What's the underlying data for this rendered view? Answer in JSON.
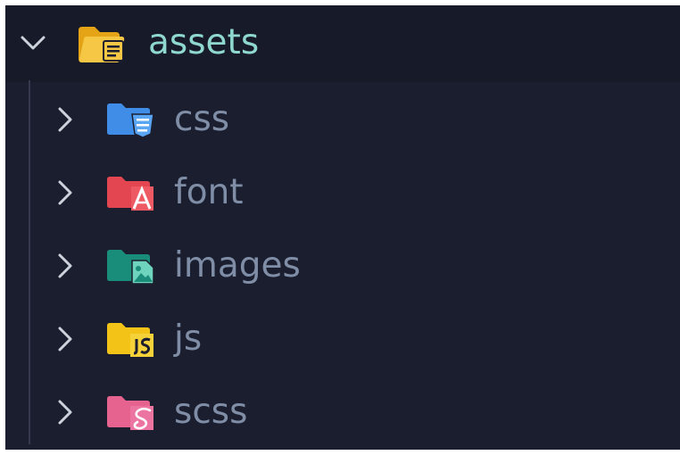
{
  "explorer": {
    "root": {
      "label": "assets",
      "expanded": true,
      "icon": "folder-open-icon",
      "icon_color": "#f2b622",
      "label_color": "#8fd8d0"
    },
    "children": [
      {
        "label": "css",
        "icon": "folder-css-icon",
        "icon_color": "#3f8de7"
      },
      {
        "label": "font",
        "icon": "folder-font-icon",
        "icon_color": "#e34650"
      },
      {
        "label": "images",
        "icon": "folder-images-icon",
        "icon_color": "#1a8d7a"
      },
      {
        "label": "js",
        "icon": "folder-js-icon",
        "icon_color": "#f3c318"
      },
      {
        "label": "scss",
        "icon": "folder-scss-icon",
        "icon_color": "#e6628f"
      }
    ],
    "colors": {
      "background": "#1b1e2e",
      "root_background": "#171a28",
      "chevron": "#cdd3dc",
      "child_label": "#7f8ea6"
    }
  }
}
